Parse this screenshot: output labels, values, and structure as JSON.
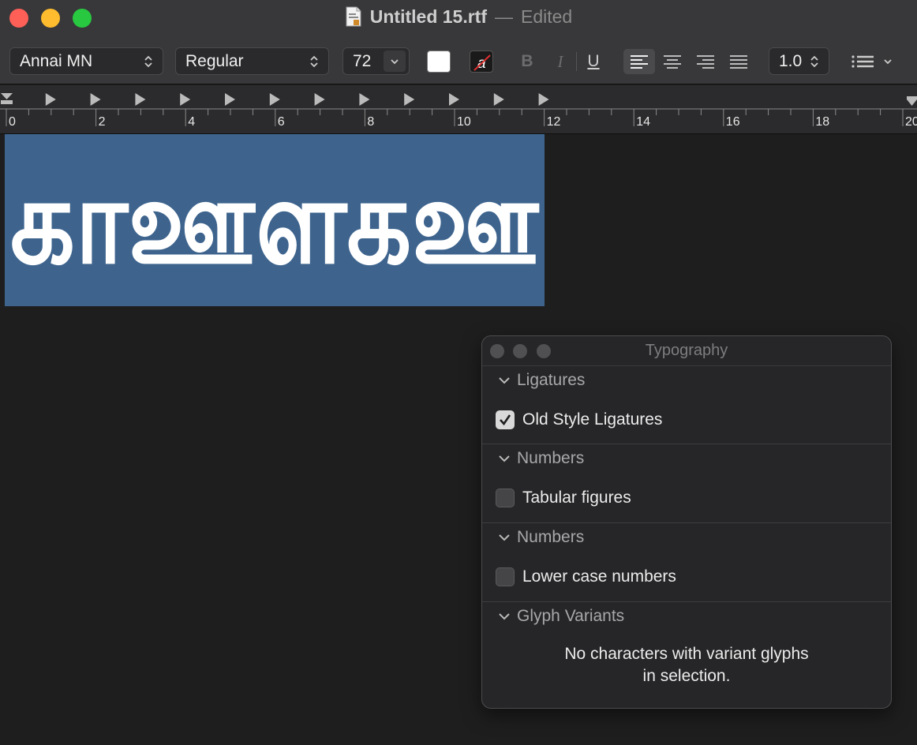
{
  "window": {
    "title": "Untitled 15.rtf",
    "separator": "—",
    "status": "Edited"
  },
  "toolbar": {
    "font_family": "Annai MN",
    "font_style": "Regular",
    "font_size": "72",
    "bold": "B",
    "italic": "I",
    "underline": "U",
    "line_spacing": "1.0",
    "text_color": "#ffffff"
  },
  "ruler": {
    "labels": [
      "0",
      "2",
      "4",
      "6",
      "8",
      "10",
      "12",
      "14",
      "16",
      "18",
      "20"
    ]
  },
  "document": {
    "text": "காஊளகஊ",
    "selection_color": "#3e648e"
  },
  "typography_panel": {
    "title": "Typography",
    "sections": [
      {
        "heading": "Ligatures",
        "option": "Old Style Ligatures",
        "checked": true
      },
      {
        "heading": "Numbers",
        "option": "Tabular figures",
        "checked": false
      },
      {
        "heading": "Numbers",
        "option": "Lower case numbers",
        "checked": false
      },
      {
        "heading": "Glyph Variants",
        "message_line1": "No characters with variant glyphs",
        "message_line2": "in selection."
      }
    ]
  }
}
